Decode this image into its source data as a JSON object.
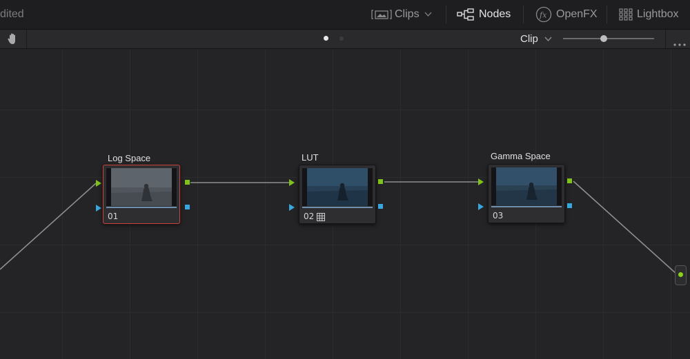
{
  "header": {
    "title_fragment": "dited",
    "tabs": [
      {
        "label": "Clips",
        "icon": "clips-icon",
        "active": false
      },
      {
        "label": "Nodes",
        "icon": "nodes-icon",
        "active": true
      },
      {
        "label": "OpenFX",
        "icon": "fx-icon",
        "active": false
      },
      {
        "label": "Lightbox",
        "icon": "grid-icon",
        "active": false
      }
    ]
  },
  "toolbar": {
    "mode_label": "Clip",
    "page_dots": 2,
    "active_page": 1,
    "zoom_level": 0.45
  },
  "nodes": [
    {
      "label": "Log Space",
      "number": "01",
      "selected": true,
      "lut": false
    },
    {
      "label": "LUT",
      "number": "02",
      "selected": false,
      "lut": true
    },
    {
      "label": "Gamma Space",
      "number": "03",
      "selected": false,
      "lut": false
    }
  ],
  "colors": {
    "selected_border": "#c9443a",
    "rgb_port": "#7ec21a",
    "alpha_port": "#39a7df"
  }
}
